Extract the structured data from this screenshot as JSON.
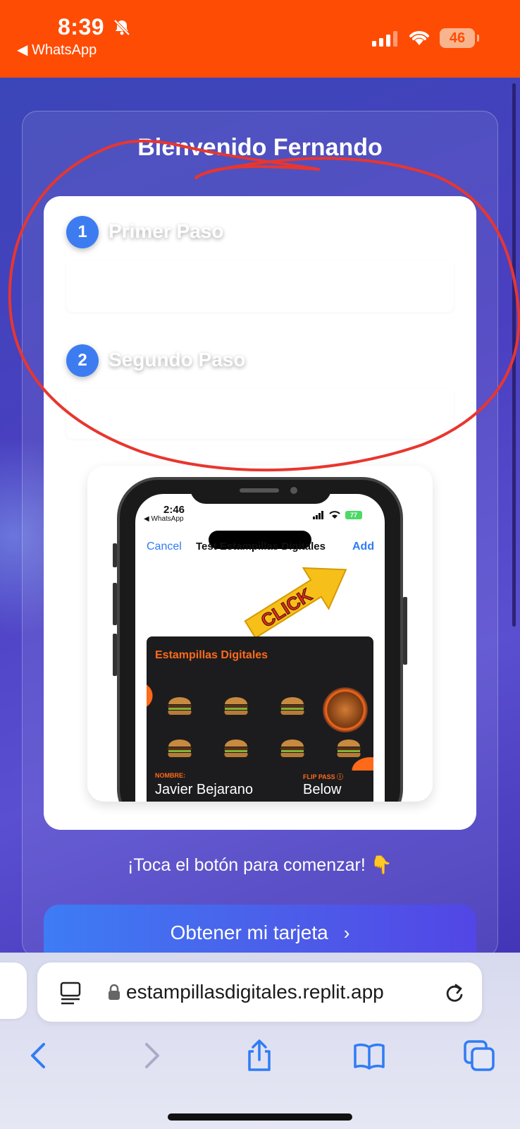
{
  "status_bar": {
    "time": "8:39",
    "back_app": "◀ WhatsApp",
    "battery": "46",
    "icons": [
      "bell-muted-icon",
      "signal-icon",
      "wifi-icon",
      "battery-icon"
    ]
  },
  "page": {
    "welcome": "Bienvenido Fernando",
    "steps": [
      {
        "number": "1",
        "label": "Primer Paso"
      },
      {
        "number": "2",
        "label": "Segundo Paso"
      }
    ],
    "hint": "¡Toca el botón para comenzar! 👇",
    "cta_label": "Obtener mi tarjeta",
    "cta_chevron": "›"
  },
  "tutorial_image": {
    "time": "2:46",
    "back_app": "◀ WhatsApp",
    "battery": "77",
    "cancel": "Cancel",
    "title": "Test Estampillas Digitales",
    "add": "Add",
    "arrow_text": "CLICK",
    "pass_name": "Estampillas Digitales",
    "nombre_label": "NOMBRE:",
    "nombre_value": "Javier Bejarano",
    "flip_label": "FLIP PASS ⓘ",
    "flip_value": "Below"
  },
  "safari": {
    "url": "estampillasdigitales.replit.app",
    "icons": [
      "reader-icon",
      "lock-icon",
      "reload-icon",
      "back-icon",
      "forward-icon",
      "share-icon",
      "bookmarks-icon",
      "tabs-icon"
    ]
  },
  "colors": {
    "status_bar": "#ff4c05",
    "accent_blue": "#3d7cf0",
    "annotation_red": "#e8362f",
    "pass_orange": "#ff6a1a"
  }
}
